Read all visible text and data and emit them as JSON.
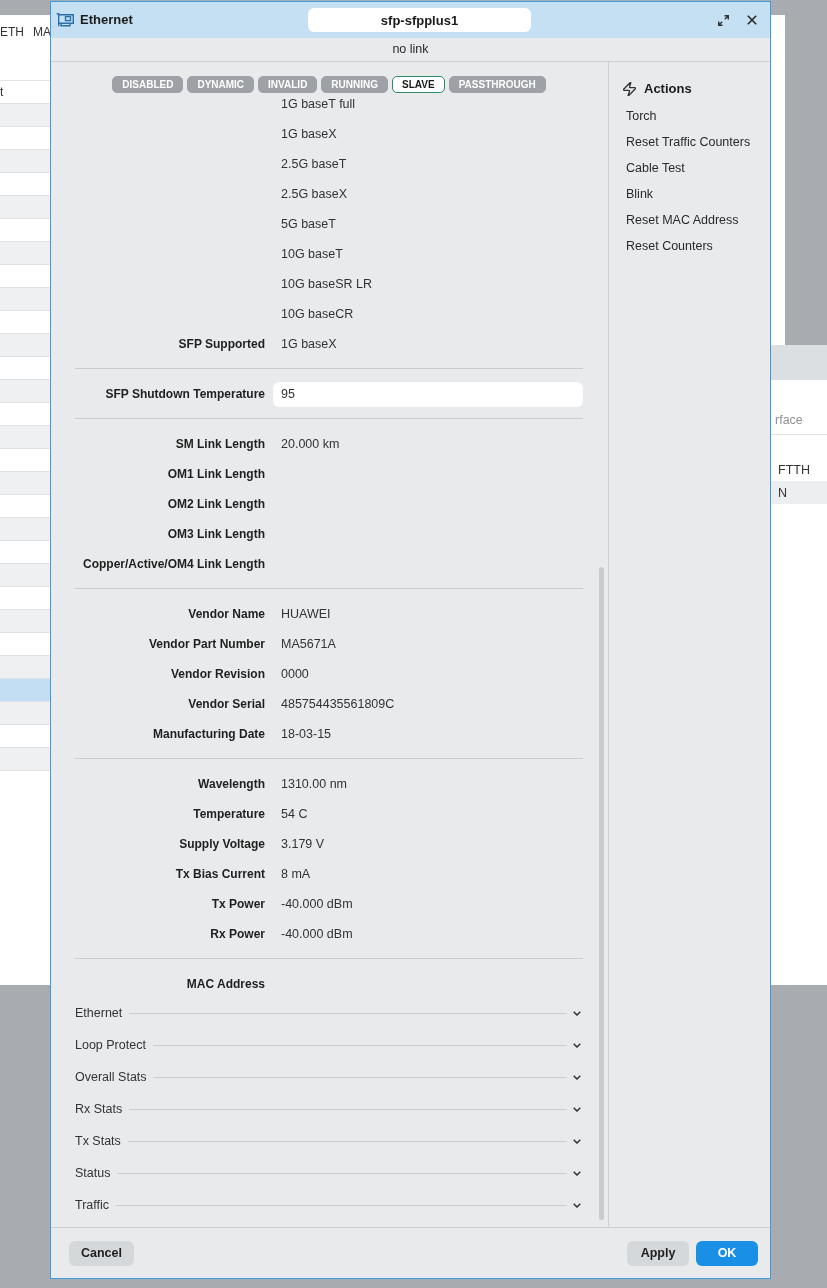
{
  "background": {
    "table_window": {
      "columns": [
        "ETH",
        "MA"
      ],
      "rows": [
        {
          "cell": "t",
          "selected": false
        },
        {
          "selected": false
        },
        {
          "selected": false
        },
        {
          "selected": false
        },
        {
          "selected": false
        },
        {
          "selected": false
        },
        {
          "selected": false
        },
        {
          "selected": false
        },
        {
          "selected": false
        },
        {
          "selected": false
        },
        {
          "selected": false
        },
        {
          "selected": false
        },
        {
          "selected": false
        },
        {
          "selected": false
        },
        {
          "selected": false
        },
        {
          "selected": false
        },
        {
          "selected": false
        },
        {
          "selected": false
        },
        {
          "selected": false
        },
        {
          "selected": false
        },
        {
          "selected": false
        },
        {
          "selected": false
        },
        {
          "selected": false
        },
        {
          "selected": false
        },
        {
          "selected": false
        },
        {
          "selected": false
        },
        {
          "selected": true
        },
        {
          "selected": false
        },
        {
          "selected": false
        },
        {
          "selected": false
        }
      ]
    },
    "side_window": {
      "search": {
        "placeholder": "rface"
      },
      "rows": [
        {
          "cell": "FTTH"
        },
        {
          "cell": "N"
        }
      ]
    }
  },
  "dialog": {
    "title": "Ethernet",
    "name": "sfp-sfpplus1",
    "status": "no link",
    "flags": [
      {
        "label": "DISABLED",
        "selected": false
      },
      {
        "label": "DYNAMIC",
        "selected": false
      },
      {
        "label": "INVALID",
        "selected": false
      },
      {
        "label": "RUNNING",
        "selected": false
      },
      {
        "label": "SLAVE",
        "selected": true
      },
      {
        "label": "PASSTHROUGH",
        "selected": false
      }
    ],
    "groups": [
      {
        "rows": [
          {
            "kind": "text",
            "value": "1G baseT full"
          },
          {
            "kind": "text",
            "value": "1G baseX"
          },
          {
            "kind": "text",
            "value": "2.5G baseT"
          },
          {
            "kind": "text",
            "value": "2.5G baseX"
          },
          {
            "kind": "text",
            "value": "5G baseT"
          },
          {
            "kind": "text",
            "value": "10G baseT"
          },
          {
            "kind": "text",
            "value": "10G baseSR LR"
          },
          {
            "kind": "text",
            "value": "10G baseCR"
          },
          {
            "kind": "text",
            "label": "SFP Supported",
            "value": "1G baseX"
          }
        ]
      },
      {
        "rows": [
          {
            "kind": "input",
            "label": "SFP Shutdown Temperature",
            "value": "95"
          }
        ]
      },
      {
        "rows": [
          {
            "kind": "text",
            "label": "SM Link Length",
            "value": "20.000 km"
          },
          {
            "kind": "text",
            "label": "OM1 Link Length"
          },
          {
            "kind": "text",
            "label": "OM2 Link Length"
          },
          {
            "kind": "text",
            "label": "OM3 Link Length"
          },
          {
            "kind": "text",
            "label": "Copper/Active/OM4 Link Length"
          }
        ]
      },
      {
        "rows": [
          {
            "kind": "text",
            "label": "Vendor Name",
            "value": "HUAWEI"
          },
          {
            "kind": "text",
            "label": "Vendor Part Number",
            "value": "MA5671A"
          },
          {
            "kind": "text",
            "label": "Vendor Revision",
            "value": "0000"
          },
          {
            "kind": "text",
            "label": "Vendor Serial",
            "value": "485754435561809C"
          },
          {
            "kind": "text",
            "label": "Manufacturing Date",
            "value": "18-03-15"
          }
        ]
      },
      {
        "rows": [
          {
            "kind": "text",
            "label": "Wavelength",
            "value": "1310.00 nm"
          },
          {
            "kind": "text",
            "label": "Temperature",
            "value": "54 C"
          },
          {
            "kind": "text",
            "label": "Supply Voltage",
            "value": "3.179 V"
          },
          {
            "kind": "text",
            "label": "Tx Bias Current",
            "value": "8 mA"
          },
          {
            "kind": "text",
            "label": "Tx Power",
            "value": "-40.000 dBm"
          },
          {
            "kind": "text",
            "label": "Rx Power",
            "value": "-40.000 dBm"
          }
        ]
      },
      {
        "rows": [
          {
            "kind": "text",
            "label": "MAC Address"
          }
        ]
      }
    ],
    "sections": [
      {
        "label": "Ethernet",
        "expanded": false
      },
      {
        "label": "Loop Protect",
        "expanded": false
      },
      {
        "label": "Overall Stats",
        "expanded": false
      },
      {
        "label": "Rx Stats",
        "expanded": false
      },
      {
        "label": "Tx Stats",
        "expanded": false
      },
      {
        "label": "Status",
        "expanded": false
      },
      {
        "label": "Traffic",
        "expanded": false
      }
    ],
    "actions": {
      "title": "Actions",
      "items": [
        "Torch",
        "Reset Traffic Counters",
        "Cable Test",
        "Blink",
        "Reset MAC Address",
        "Reset Counters"
      ]
    },
    "footer": {
      "left": [
        {
          "label": "Cancel",
          "kind": "secondary"
        }
      ],
      "right": [
        {
          "label": "Apply",
          "kind": "secondary"
        },
        {
          "label": "OK",
          "kind": "primary"
        }
      ]
    }
  }
}
